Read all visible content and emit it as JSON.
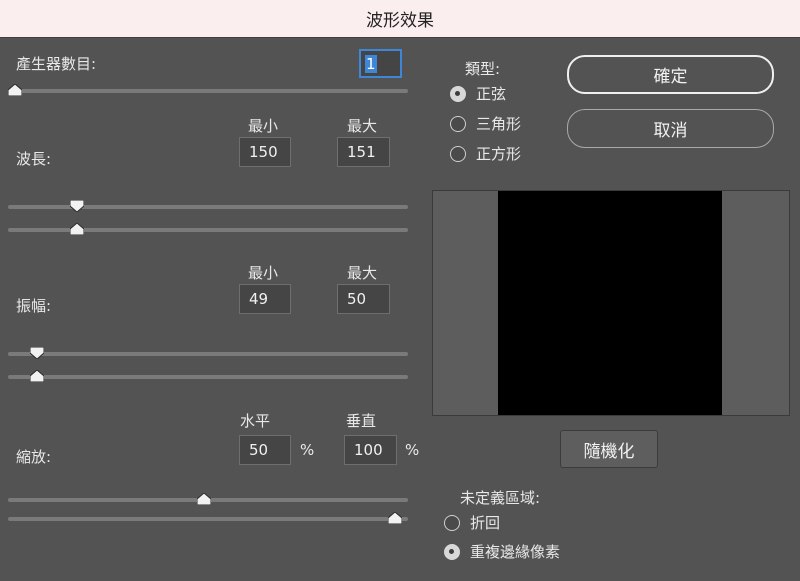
{
  "window": {
    "title": "波形效果"
  },
  "generators": {
    "label": "產生器數目:",
    "value": "1",
    "slider": 0.0
  },
  "wavelength": {
    "label": "波長:",
    "min_header": "最小",
    "max_header": "最大",
    "min": "150",
    "max": "151",
    "slider_min": 0.16,
    "slider_max": 0.16
  },
  "amplitude": {
    "label": "振幅:",
    "min_header": "最小",
    "max_header": "最大",
    "min": "49",
    "max": "50",
    "slider_min": 0.057,
    "slider_max": 0.057
  },
  "scale": {
    "label": "縮放:",
    "h_header": "水平",
    "v_header": "垂直",
    "h": "50",
    "v": "100",
    "unit": "%",
    "slider_h": 0.49,
    "slider_v": 0.985
  },
  "type": {
    "label": "類型:",
    "options": [
      "正弦",
      "三角形",
      "正方形"
    ],
    "selected": 0
  },
  "buttons": {
    "ok": "確定",
    "cancel": "取消",
    "randomize": "隨機化"
  },
  "undefined_area": {
    "label": "未定義區域:",
    "options": [
      "折回",
      "重複邊緣像素"
    ],
    "selected": 1
  },
  "colors": {
    "background": "#535353",
    "focus": "#3f86d6",
    "preview": "#000000"
  }
}
